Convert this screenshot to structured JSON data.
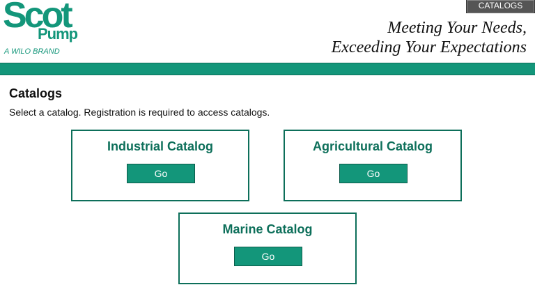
{
  "header": {
    "logo": {
      "word1": "Scot",
      "word2": "Pump",
      "brand": "A WILO BRAND"
    },
    "catalogs_tab": "CATALOGS",
    "tagline": {
      "line1": "Meeting Your Needs,",
      "line2": "Exceeding Your Expectations"
    }
  },
  "main": {
    "title": "Catalogs",
    "subtitle": "Select a catalog. Registration is required to access catalogs.",
    "cards": [
      {
        "title": "Industrial Catalog",
        "button": "Go"
      },
      {
        "title": "Agricultural Catalog",
        "button": "Go"
      },
      {
        "title": "Marine Catalog",
        "button": "Go"
      }
    ]
  },
  "colors": {
    "brand_green": "#13967a",
    "dark_green": "#0d6f5a",
    "tab_gray": "#555555"
  }
}
